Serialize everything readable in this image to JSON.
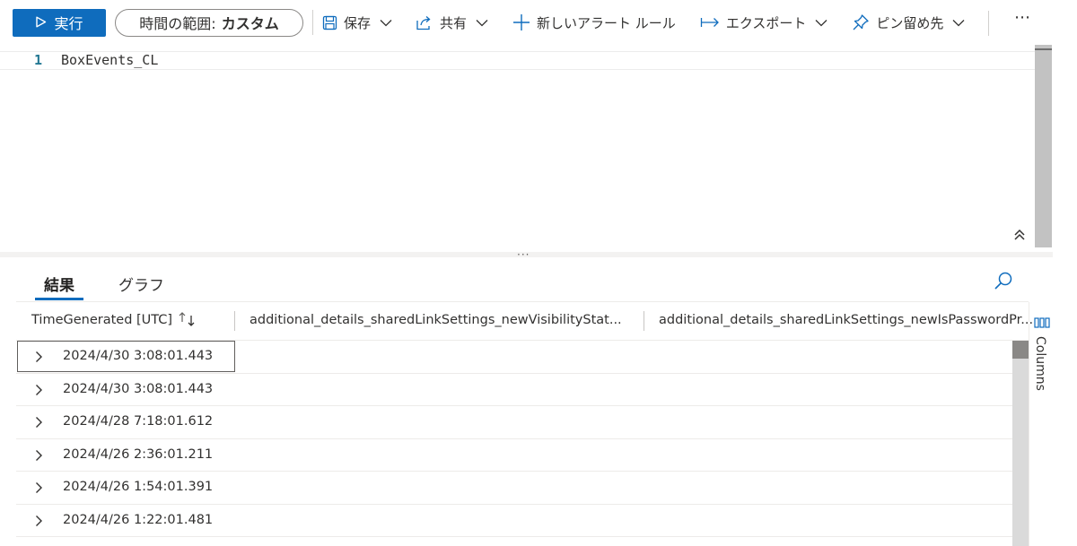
{
  "toolbar": {
    "run_label": "実行",
    "time_range_label": "時間の範囲:",
    "time_range_value": "カスタム",
    "save_label": "保存",
    "share_label": "共有",
    "new_alert_label": "新しいアラート ルール",
    "export_label": "エクスポート",
    "pin_label": "ピン留め先",
    "more_label": "⋯"
  },
  "editor": {
    "line_number": "1",
    "query": "BoxEvents_CL",
    "splitter_label": "···"
  },
  "results": {
    "tabs": [
      {
        "label": "結果",
        "active": true
      },
      {
        "label": "グラフ",
        "active": false
      }
    ],
    "columns": [
      "TimeGenerated [UTC]",
      "additional_details_sharedLinkSettings_newVisibilityStat...",
      "additional_details_sharedLinkSettings_newIsPasswordPr..."
    ],
    "rows": [
      {
        "time": "2024/4/30 3:08:01.443"
      },
      {
        "time": "2024/4/30 3:08:01.443"
      },
      {
        "time": "2024/4/28 7:18:01.612"
      },
      {
        "time": "2024/4/26 2:36:01.211"
      },
      {
        "time": "2024/4/26 1:54:01.391"
      },
      {
        "time": "2024/4/26 1:22:01.481"
      }
    ],
    "columns_panel_label": "Columns"
  },
  "colors": {
    "accent": "#0f6cbd",
    "text": "#323130",
    "border": "#edebe9"
  }
}
